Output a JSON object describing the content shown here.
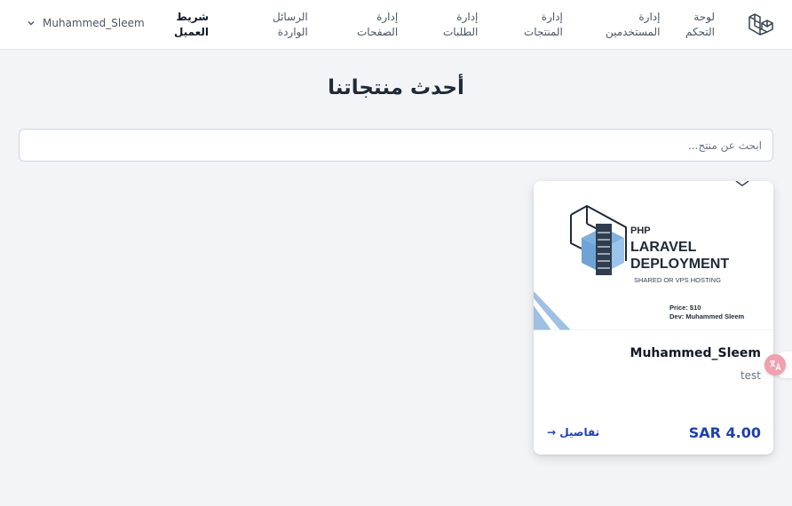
{
  "nav": {
    "links": [
      {
        "line1": "لوحة",
        "line2": "التحكم"
      },
      {
        "line1": "إدارة",
        "line2": "المستخدمين"
      },
      {
        "line1": "إدارة",
        "line2": "المنتجات"
      },
      {
        "line1": "إدارة",
        "line2": "الطلبات"
      },
      {
        "line1": "إدارة",
        "line2": "الصفحات"
      },
      {
        "line1": "الرسائل",
        "line2": "الواردة"
      },
      {
        "line1": "شريط",
        "line2": "العميل"
      }
    ],
    "user_name": "Muhammed_Sleem"
  },
  "main": {
    "title": "أحدث منتجاتنا",
    "search_placeholder": "ابحث عن منتج..."
  },
  "products": [
    {
      "image": {
        "tag": "PHP",
        "title_line1": "LARAVEL",
        "title_line2": "DEPLOYMENT",
        "subtitle": "SHARED OR VPS HOSTING",
        "price_line": "Price: $10",
        "dev_line": "Dev: Muhammed Sleem"
      },
      "owner": "Muhammed_Sleem",
      "description": "test",
      "price": "SAR 4.00",
      "details_label": "تفاصيل →"
    }
  ],
  "colors": {
    "accent": "#1e40af",
    "page_bg": "#f3f4f6",
    "translate_badge": "#f0a0ae"
  },
  "icons": {
    "logo": "laravel-logo-icon",
    "user_dropdown": "chevron-down-icon",
    "translate": "translate-icon"
  }
}
